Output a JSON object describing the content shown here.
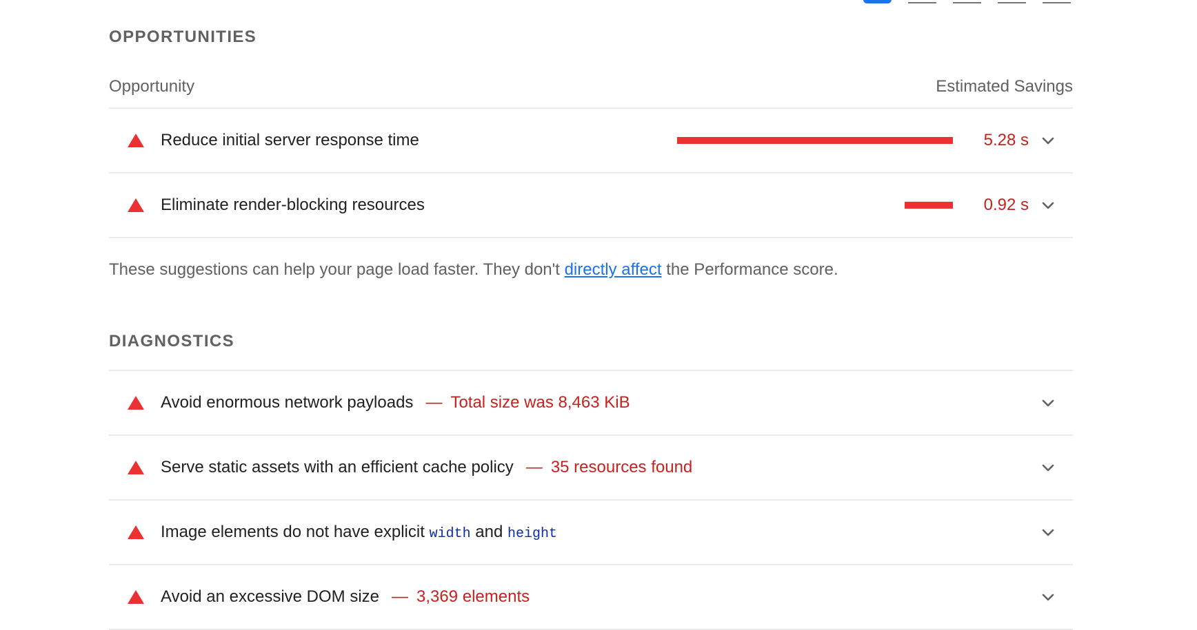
{
  "tabs": [
    {
      "active": true
    },
    {
      "active": false
    },
    {
      "active": false
    },
    {
      "active": false
    },
    {
      "active": false
    }
  ],
  "opportunities": {
    "section_title": "OPPORTUNITIES",
    "col_left": "Opportunity",
    "col_right": "Estimated Savings",
    "items": [
      {
        "title": "Reduce initial server response time",
        "savings": "5.28 s",
        "savings_seconds": 5.28
      },
      {
        "title": "Eliminate render-blocking resources",
        "savings": "0.92 s",
        "savings_seconds": 0.92
      }
    ],
    "note_prefix": "These suggestions can help your page load faster. They don't ",
    "note_link": "directly affect",
    "note_suffix": " the Performance score."
  },
  "diagnostics": {
    "section_title": "DIAGNOSTICS",
    "items": [
      {
        "title": "Avoid enormous network payloads",
        "dash": "—",
        "display": "Total size was 8,463 KiB"
      },
      {
        "title": "Serve static assets with an efficient cache policy",
        "dash": "—",
        "display": "35 resources found"
      },
      {
        "title_prefix": "Image elements do not have explicit ",
        "code1": "width",
        "title_mid": " and ",
        "code2": "height"
      },
      {
        "title": "Avoid an excessive DOM size",
        "dash": "—",
        "display": "3,369 elements"
      }
    ]
  },
  "colors": {
    "fail": "#eb3131",
    "fail_text": "#c7221f",
    "link": "#1a73e8",
    "code": "#0b2ea8"
  },
  "icons": {
    "audit_status": "fail-triangle-icon",
    "expand": "chevron-down-icon"
  }
}
